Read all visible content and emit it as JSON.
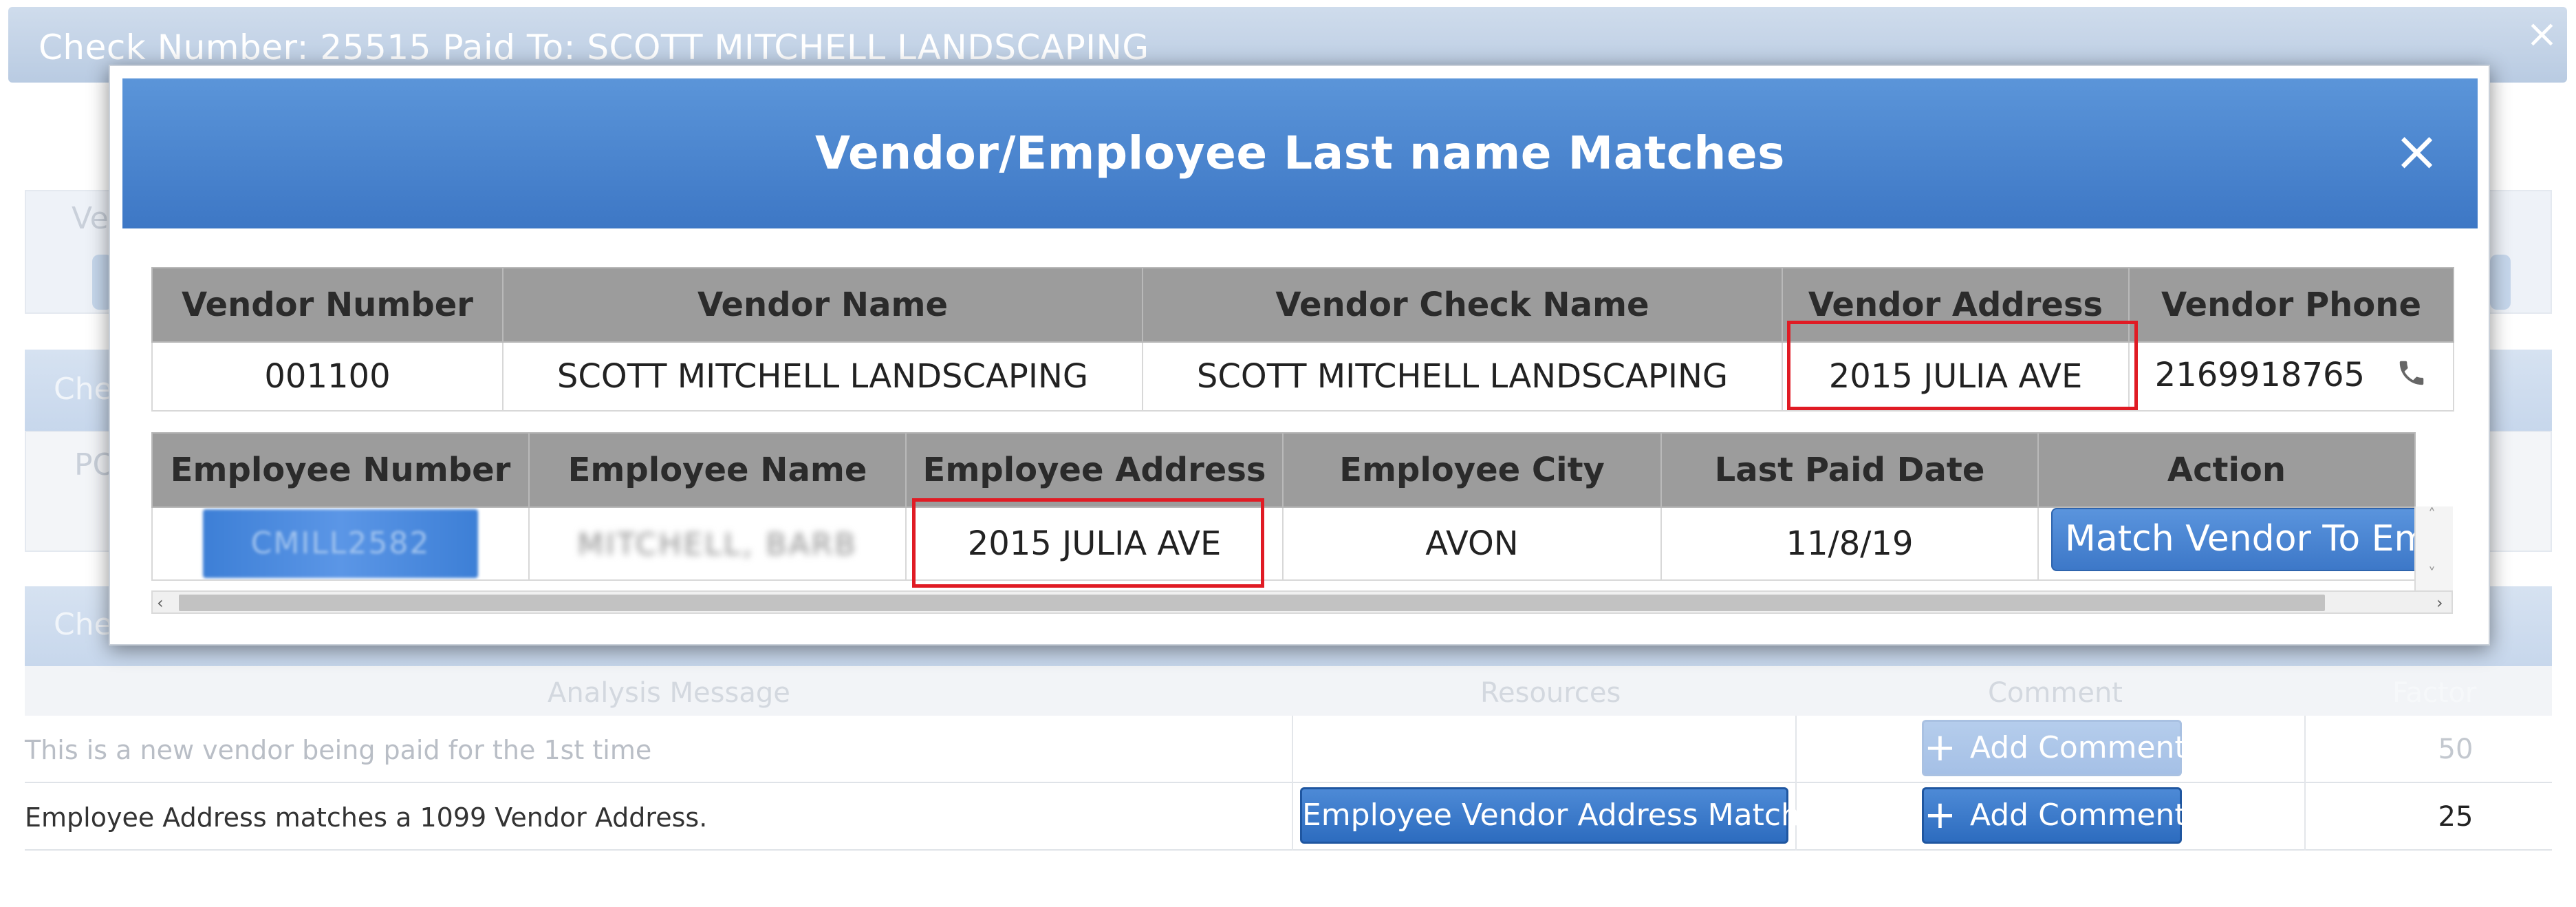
{
  "background": {
    "title": "Check Number: 25515 Paid To: SCOTT MITCHELL LANDSCAPING",
    "close_icon": "×",
    "stub_labels": [
      "Ve",
      "Che",
      "PO",
      "Che"
    ],
    "analysis": {
      "headers": [
        "Analysis Message",
        "Resources",
        "Comment",
        "Factor"
      ],
      "rows": [
        {
          "message": "This is a new vendor being paid for the 1st time",
          "resource": "",
          "comment": "Add Comment",
          "factor": "50"
        },
        {
          "message": "Employee Address matches a 1099 Vendor Address.",
          "resource": "Employee Vendor Address Match",
          "comment": "Add Comment",
          "factor": "25"
        }
      ]
    }
  },
  "modal": {
    "title": "Vendor/Employee Last name Matches",
    "close_icon": "×",
    "vendor_table": {
      "headers": [
        "Vendor Number",
        "Vendor Name",
        "Vendor Check Name",
        "Vendor Address",
        "Vendor Phone"
      ],
      "row": {
        "number": "001100",
        "name": "SCOTT MITCHELL LANDSCAPING",
        "check_name": "SCOTT MITCHELL LANDSCAPING",
        "address": "2015 JULIA AVE",
        "phone": "2169918765"
      },
      "phone_icon": "phone-icon"
    },
    "employee_table": {
      "headers": [
        "Employee Number",
        "Employee Name",
        "Employee Address",
        "Employee City",
        "Last Paid Date",
        "Action"
      ],
      "row": {
        "number": "CMILL2582",
        "name": "MITCHELL, BARB",
        "address": "2015 JULIA AVE",
        "city": "AVON",
        "last_paid": "11/8/19",
        "action": "Match Vendor To Empl"
      }
    }
  },
  "colors": {
    "modal_header": "#4a85d0",
    "table_header": "#9c9c9c",
    "highlight_box": "#e01b24",
    "button_blue": "#3d78c8"
  }
}
